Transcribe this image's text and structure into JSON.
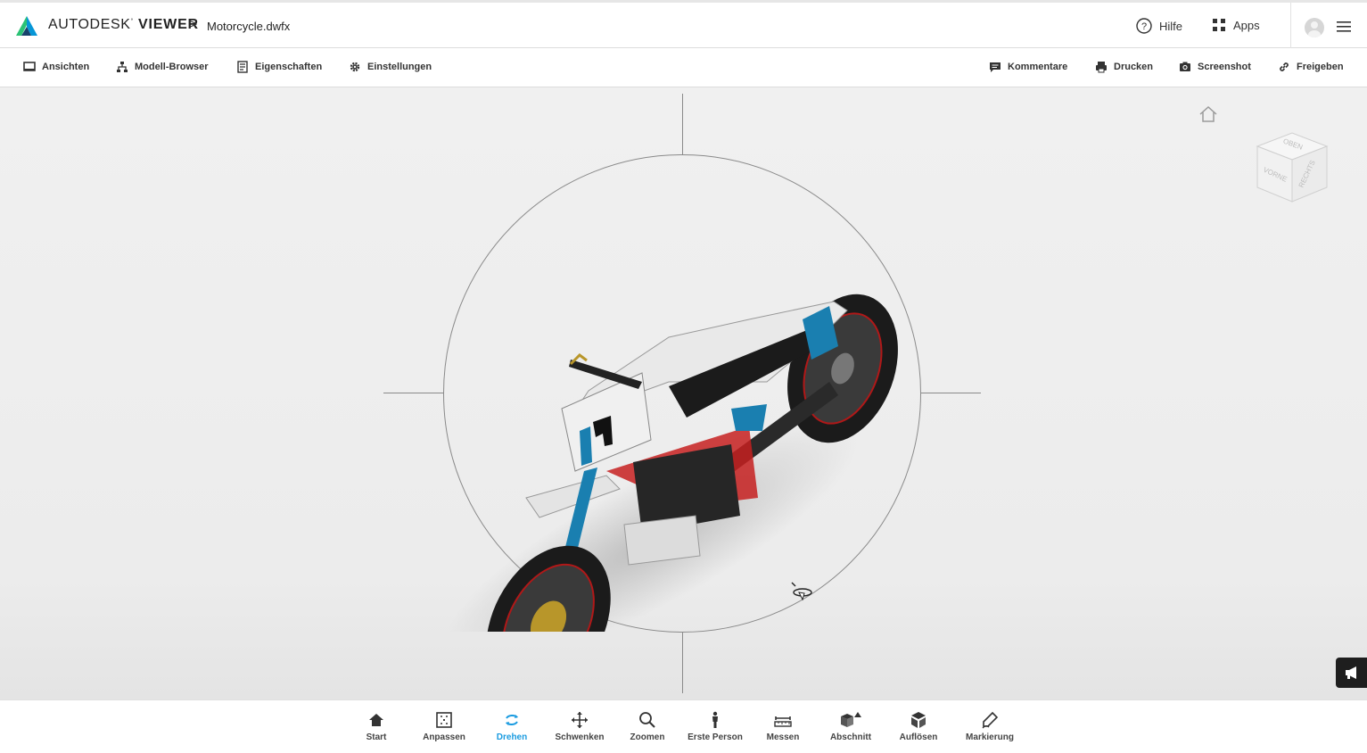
{
  "header": {
    "brand_light": "AUTODESK",
    "brand_bold": "VIEWER",
    "breadcrumb_sep": ">",
    "filename": "Motorcycle.dwfx",
    "help_label": "Hilfe",
    "apps_label": "Apps"
  },
  "toolbar": {
    "left": [
      {
        "label": "Ansichten",
        "icon": "monitor-icon"
      },
      {
        "label": "Modell-Browser",
        "icon": "hierarchy-icon"
      },
      {
        "label": "Eigenschaften",
        "icon": "document-icon"
      },
      {
        "label": "Einstellungen",
        "icon": "gear-icon"
      }
    ],
    "right": [
      {
        "label": "Kommentare",
        "icon": "comment-icon"
      },
      {
        "label": "Drucken",
        "icon": "printer-icon"
      },
      {
        "label": "Screenshot",
        "icon": "camera-icon"
      },
      {
        "label": "Freigeben",
        "icon": "link-icon"
      }
    ]
  },
  "viewcube": {
    "top": "OBEN",
    "front": "VORNE",
    "right": "RECHTS"
  },
  "bottombar": {
    "active": "Drehen",
    "items": [
      {
        "label": "Start",
        "icon": "home-icon"
      },
      {
        "label": "Anpassen",
        "icon": "fit-icon"
      },
      {
        "label": "Drehen",
        "icon": "orbit-icon"
      },
      {
        "label": "Schwenken",
        "icon": "pan-icon"
      },
      {
        "label": "Zoomen",
        "icon": "zoom-icon"
      },
      {
        "label": "Erste Person",
        "icon": "person-icon"
      },
      {
        "label": "Messen",
        "icon": "measure-icon"
      },
      {
        "label": "Abschnitt",
        "icon": "section-icon"
      },
      {
        "label": "Auflösen",
        "icon": "explode-icon"
      },
      {
        "label": "Markierung",
        "icon": "markup-icon"
      }
    ]
  },
  "colors": {
    "accent": "#1a9be0",
    "toolbar_text": "#333333",
    "viewport_bg": "#eeeeee"
  }
}
